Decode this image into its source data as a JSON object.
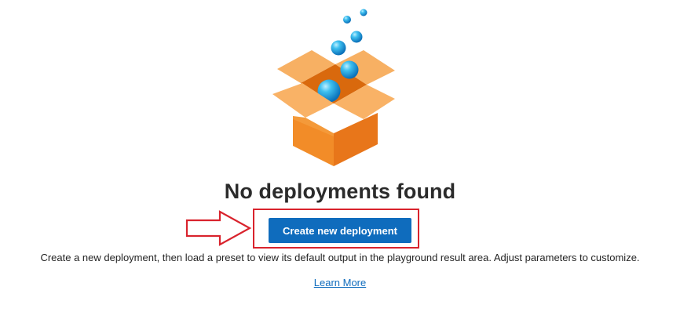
{
  "empty_state": {
    "title": "No deployments found",
    "primary_button_label": "Create new deployment",
    "description": "Create a new deployment, then load a preset to view its default output in the playground result area. Adjust parameters to customize.",
    "learn_more_label": "Learn More",
    "illustration_icon": "open-box-with-bubbles-icon"
  },
  "annotation": {
    "arrow_icon": "right-arrow-icon",
    "highlight_color": "#d9232d"
  },
  "colors": {
    "accent": "#0f6cbd",
    "box_orange": "#f28c28",
    "bubble_blue": "#1fa3e0"
  }
}
